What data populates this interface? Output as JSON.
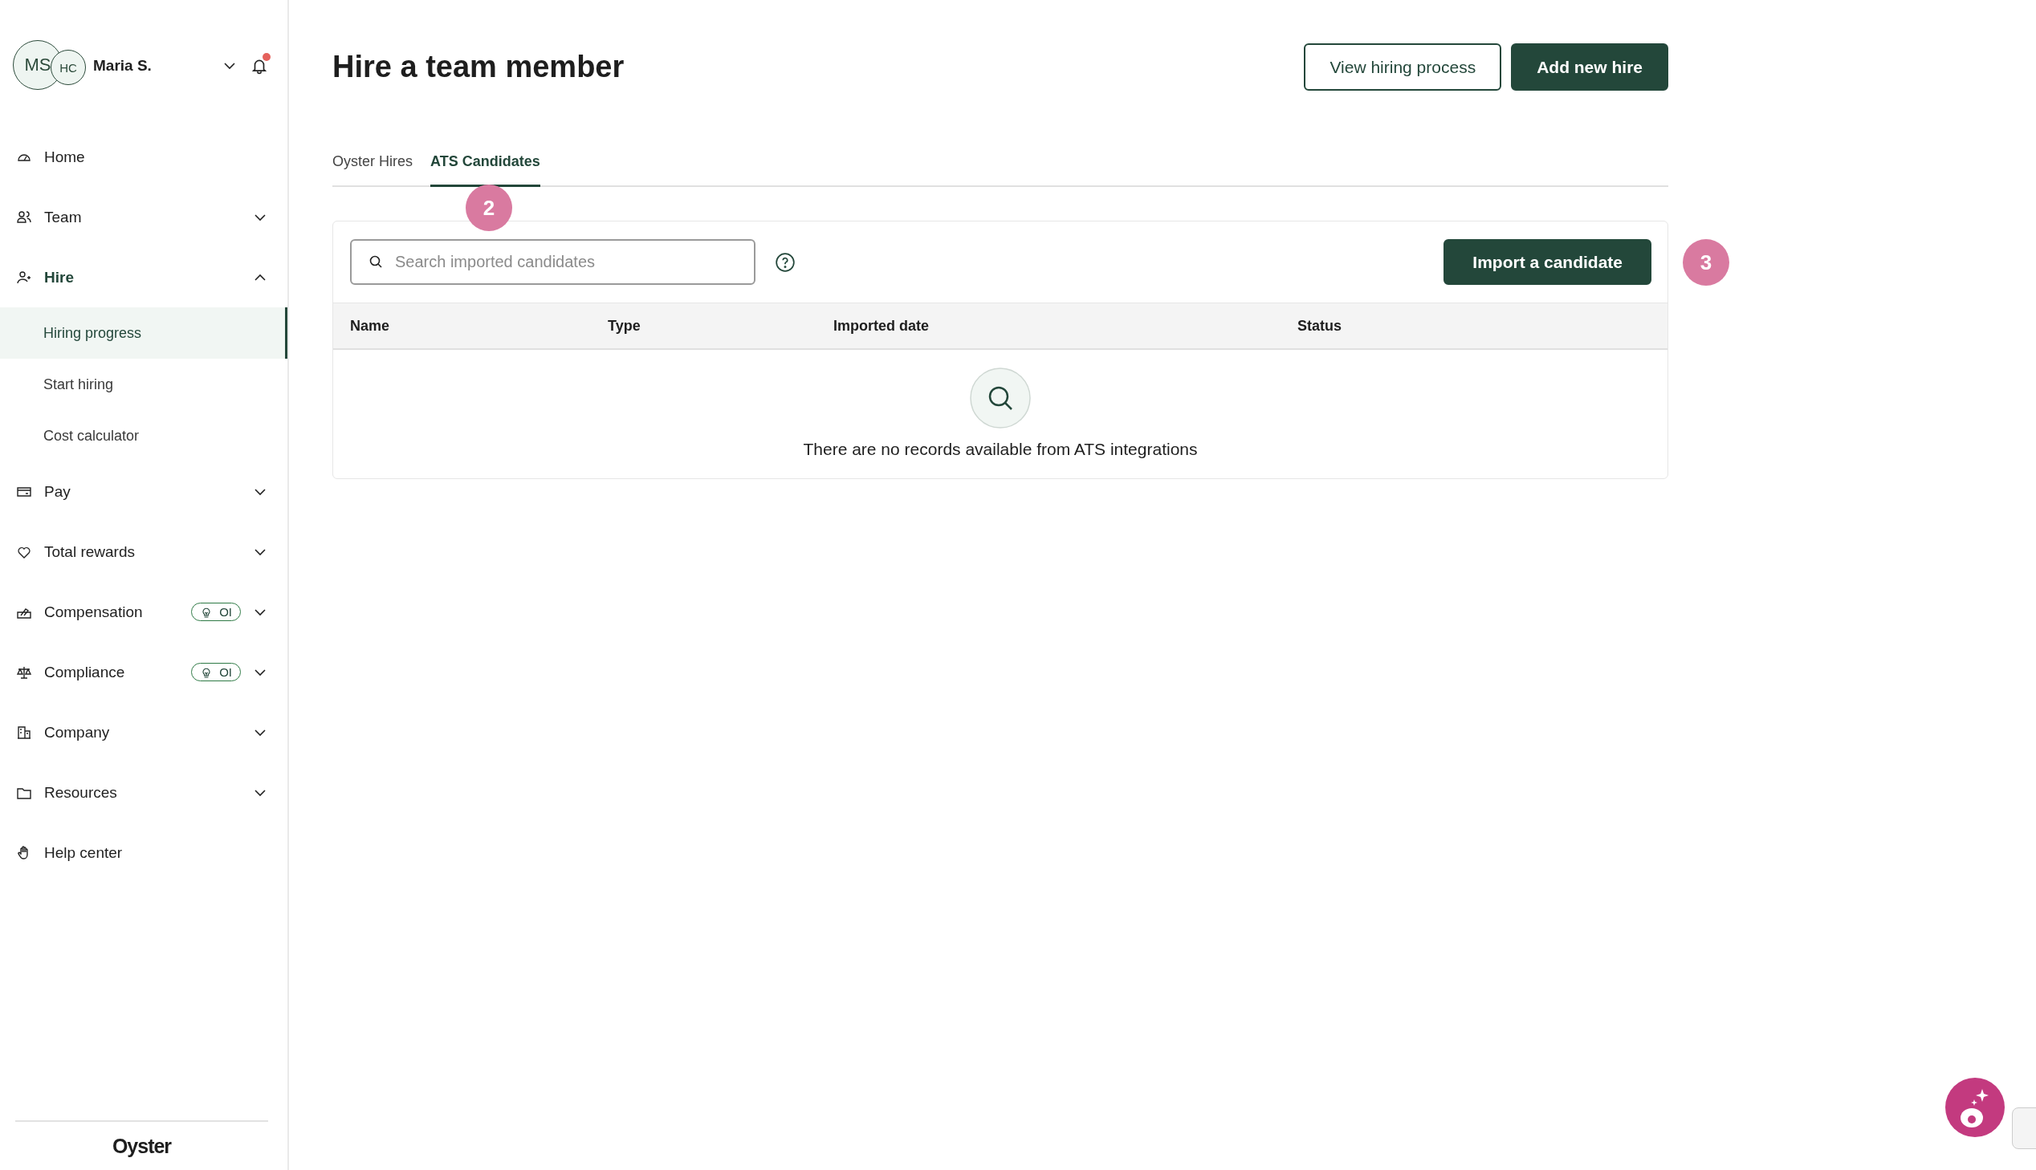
{
  "user": {
    "initials": "MS",
    "secondary_initials": "HC",
    "name": "Maria S.",
    "notification": true
  },
  "nav": [
    {
      "label": "Home"
    },
    {
      "label": "Team",
      "expanded": false
    },
    {
      "label": "Hire",
      "expanded": true,
      "children": [
        {
          "label": "Hiring progress",
          "selected": true
        },
        {
          "label": "Start hiring",
          "selected": false
        },
        {
          "label": "Cost calculator",
          "selected": false
        }
      ]
    },
    {
      "label": "Pay",
      "expanded": false
    },
    {
      "label": "Total rewards",
      "expanded": false
    },
    {
      "label": "Compensation",
      "expanded": false,
      "badge": "OI"
    },
    {
      "label": "Compliance",
      "expanded": false,
      "badge": "OI"
    },
    {
      "label": "Company",
      "expanded": false
    },
    {
      "label": "Resources",
      "expanded": false
    },
    {
      "label": "Help center"
    }
  ],
  "brand": "Oyster",
  "page_title": "Hire a team member",
  "header_buttons": [
    {
      "label": "View hiring process",
      "kind": "secondary"
    },
    {
      "label": "Add new hire",
      "kind": "primary"
    }
  ],
  "tabs": [
    {
      "label": "Oyster Hires",
      "selected": false
    },
    {
      "label": "ATS Candidates",
      "selected": true
    }
  ],
  "search": {
    "placeholder": "Search imported candidates"
  },
  "import_button": "Import a candidate",
  "table": {
    "columns": [
      "Name",
      "Type",
      "Imported date",
      "Status"
    ],
    "empty_message": "There are no records available from ATS integrations"
  },
  "markers": [
    "2",
    "3"
  ]
}
